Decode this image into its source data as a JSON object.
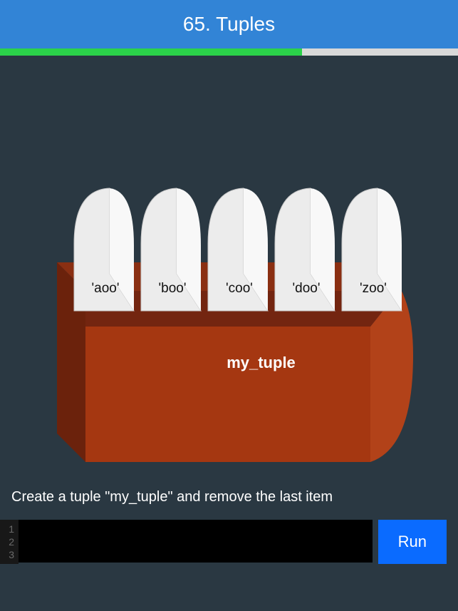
{
  "header": {
    "title": "65. Tuples"
  },
  "progress": {
    "percent": 66
  },
  "tuple": {
    "name": "my_tuple",
    "items": [
      "'aoo'",
      "'boo'",
      "'coo'",
      "'doo'",
      "'zoo'"
    ]
  },
  "instruction": "Create a  tuple \"my_tuple\" and remove the last item",
  "editor": {
    "line_numbers": [
      "1",
      "2",
      "3"
    ],
    "code": ""
  },
  "run_button": "Run"
}
